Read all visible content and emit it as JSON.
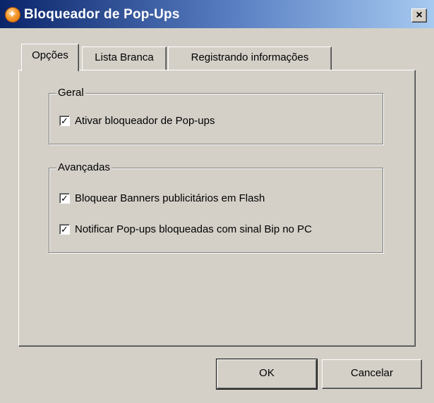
{
  "window": {
    "title": "Bloqueador de Pop-Ups",
    "close_glyph": "×"
  },
  "tabs": [
    {
      "label": "Opções",
      "active": true
    },
    {
      "label": "Lista Branca",
      "active": false
    },
    {
      "label": "Registrando informações",
      "active": false
    }
  ],
  "groups": {
    "geral": {
      "title": "Geral",
      "items": [
        {
          "label": "Ativar bloqueador de Pop-ups",
          "checked": true
        }
      ]
    },
    "avancadas": {
      "title": "Avançadas",
      "items": [
        {
          "label": "Bloquear Banners publicitários em Flash",
          "checked": true
        },
        {
          "label": "Notificar Pop-ups bloqueadas com sinal Bip no PC",
          "checked": true
        }
      ]
    }
  },
  "buttons": {
    "ok": "OK",
    "cancel": "Cancelar"
  },
  "check_glyph": "✓",
  "icons": {
    "app": "popup-blocker-icon",
    "close": "close-icon"
  },
  "colors": {
    "face": "#d4d0c8",
    "title_start": "#0a246a",
    "title_end": "#a6caf0"
  }
}
